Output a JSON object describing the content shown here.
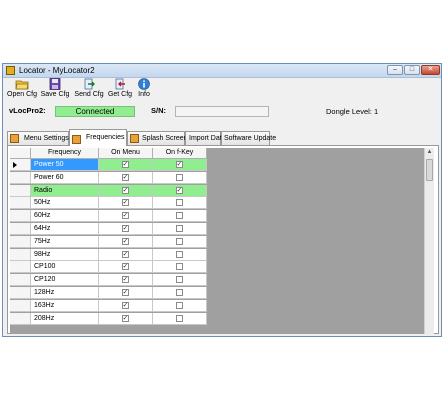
{
  "window": {
    "title": "Locator - MyLocator2",
    "buttons": {
      "minimize": "–",
      "maximize": "□",
      "close": "✕"
    }
  },
  "toolbar": {
    "open_cfg": "Open Cfg",
    "save_cfg": "Save Cfg",
    "send_cfg": "Send Cfg",
    "get_cfg": "Get Cfg",
    "info": "Info"
  },
  "status": {
    "device_label": "vLocPro2:",
    "connection": "Connected",
    "sn_label": "S/N:",
    "sn_value": "",
    "dongle_level": "Dongle Level: 1"
  },
  "tabs": [
    "Menu Settings",
    "Frequencies",
    "Splash Screen",
    "Import Data",
    "Software Update"
  ],
  "active_tab": "Frequencies",
  "table": {
    "columns": [
      "Frequency",
      "On Menu",
      "On f-Key"
    ],
    "rows": [
      {
        "name": "Power 50",
        "on_menu": true,
        "on_fkey": true,
        "selected": true,
        "green": true
      },
      {
        "name": "Power 60",
        "on_menu": true,
        "on_fkey": false
      },
      {
        "name": "Radio",
        "on_menu": true,
        "on_fkey": true,
        "green": true
      },
      {
        "name": "50Hz",
        "on_menu": true,
        "on_fkey": false
      },
      {
        "name": "60Hz",
        "on_menu": true,
        "on_fkey": false
      },
      {
        "name": "64Hz",
        "on_menu": true,
        "on_fkey": false
      },
      {
        "name": "75Hz",
        "on_menu": true,
        "on_fkey": false
      },
      {
        "name": "98Hz",
        "on_menu": true,
        "on_fkey": false
      },
      {
        "name": "CP100",
        "on_menu": true,
        "on_fkey": false
      },
      {
        "name": "CP120",
        "on_menu": true,
        "on_fkey": false
      },
      {
        "name": "128Hz",
        "on_menu": true,
        "on_fkey": false
      },
      {
        "name": "163Hz",
        "on_menu": true,
        "on_fkey": false
      },
      {
        "name": "208Hz",
        "on_menu": true,
        "on_fkey": false
      }
    ]
  },
  "colors": {
    "connected_bg": "#90ee90",
    "row_highlight": "#90ee90",
    "selection": "#3399ff",
    "grid_empty": "#a0a0a0"
  },
  "icons": {
    "app": "locator-app-icon",
    "open": "open-folder-icon",
    "save": "save-disk-icon",
    "send": "send-arrow-icon",
    "get": "get-arrow-icon",
    "info": "info-icon",
    "tab": "tab-folder-icon"
  }
}
